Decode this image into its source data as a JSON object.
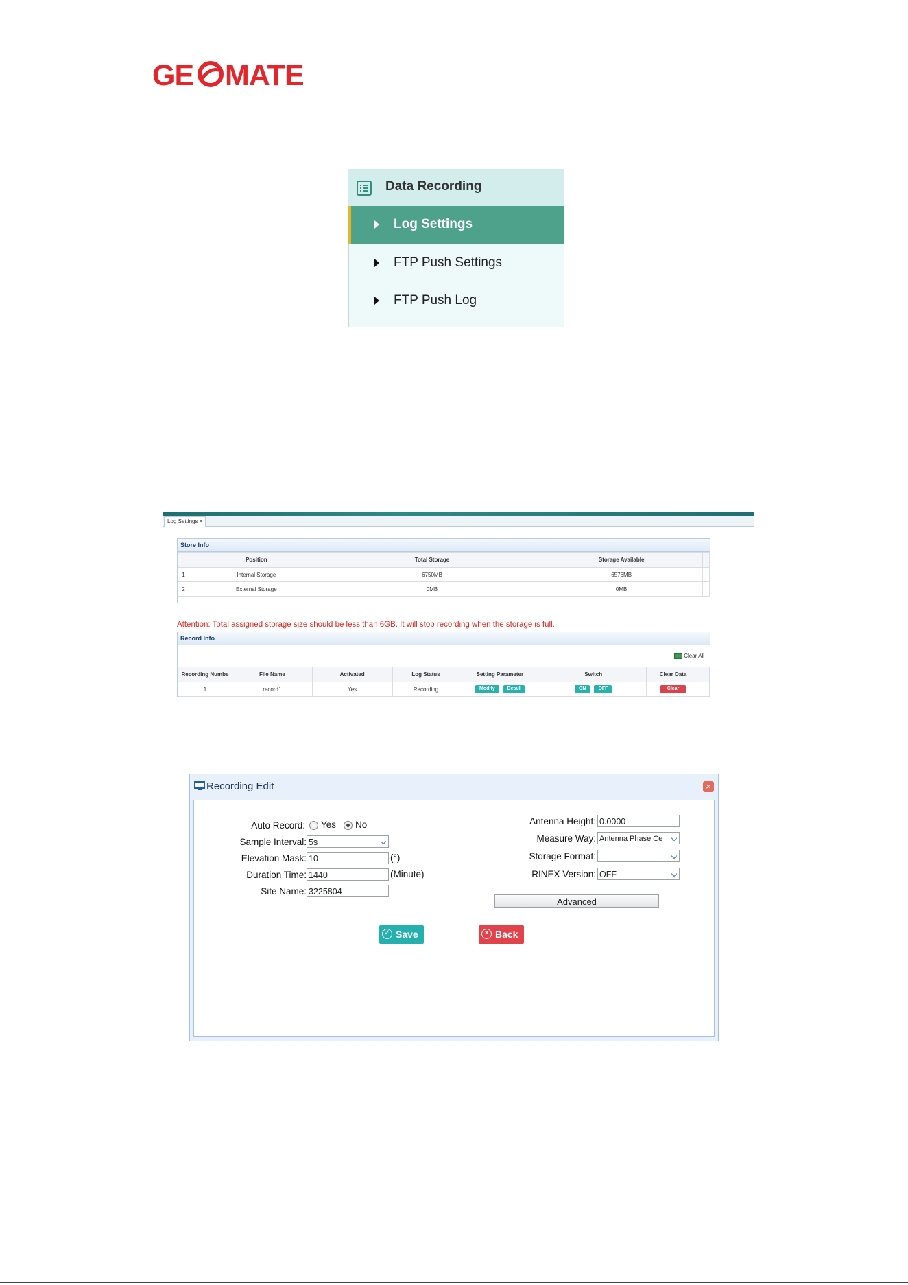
{
  "brand": {
    "logo_text": "GEOMATE",
    "color": "#e3262b"
  },
  "nav": {
    "section_icon": "list-icon",
    "section_title": "Data Recording",
    "items": [
      {
        "label": "Log Settings",
        "active": true
      },
      {
        "label": "FTP Push Settings",
        "active": false
      },
      {
        "label": "FTP Push Log",
        "active": false
      }
    ]
  },
  "log_settings": {
    "tab_label": "Log Settings",
    "store_info": {
      "title": "Store Info",
      "columns": [
        "",
        "Position",
        "Total Storage",
        "Storage Available"
      ],
      "rows": [
        [
          "1",
          "Internal Storage",
          "6750MB",
          "6576MB"
        ],
        [
          "2",
          "External Storage",
          "0MB",
          "0MB"
        ]
      ]
    },
    "attention": "Attention: Total assigned storage size should be less than 6GB. It will stop recording when the storage is full.",
    "record_info": {
      "title": "Record Info",
      "clear_all": "Clear All",
      "columns": [
        "Recording Numbe",
        "File Name",
        "Activated",
        "Log Status",
        "Setting Parameter",
        "Switch",
        "Clear Data"
      ],
      "row": {
        "number": "1",
        "file_name": "record1",
        "activated": "Yes",
        "log_status": "Recording",
        "modify": "Modify",
        "detail": "Detail",
        "on": "ON",
        "off": "OFF",
        "clear": "Clear"
      }
    }
  },
  "recording_edit": {
    "title": "Recording Edit",
    "auto_record_label": "Auto Record:",
    "auto_record_yes": "Yes",
    "auto_record_no": "No",
    "auto_record_value": "No",
    "sample_interval_label": "Sample Interval:",
    "sample_interval_value": "5s",
    "elevation_mask_label": "Elevation Mask:",
    "elevation_mask_value": "10",
    "elevation_mask_unit": "(°)",
    "duration_time_label": "Duration Time:",
    "duration_time_value": "1440",
    "duration_time_unit": "(Minute)",
    "site_name_label": "Site Name:",
    "site_name_value": "3225804",
    "antenna_height_label": "Antenna Height:",
    "antenna_height_value": "0.0000",
    "measure_way_label": "Measure Way:",
    "measure_way_value": "Antenna Phase Ce",
    "storage_format_label": "Storage Format:",
    "storage_format_value": "",
    "rinex_version_label": "RINEX Version:",
    "rinex_version_value": "OFF",
    "advanced_label": "Advanced",
    "save_label": "Save",
    "back_label": "Back"
  }
}
